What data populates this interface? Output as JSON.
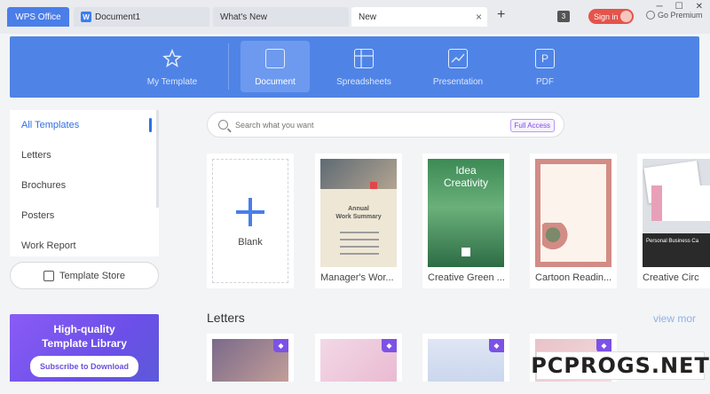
{
  "tabs": {
    "app": "WPS Office",
    "document": "Document1",
    "whats_new": "What's New",
    "new": "New",
    "add_icon": "+",
    "close_icon": "×"
  },
  "header": {
    "count_badge": "3",
    "sign_in": "Sign in",
    "premium": "Go Premium",
    "minimize": "─",
    "maximize": "☐",
    "close": "✕"
  },
  "categories": [
    {
      "label": "My Template",
      "icon": "star-icon"
    },
    {
      "label": "Document",
      "icon": "document-icon"
    },
    {
      "label": "Spreadsheets",
      "icon": "spreadsheet-icon"
    },
    {
      "label": "Presentation",
      "icon": "presentation-icon"
    },
    {
      "label": "PDF",
      "icon": "pdf-icon"
    }
  ],
  "sidebar": {
    "items": [
      "All Templates",
      "Letters",
      "Brochures",
      "Posters",
      "Work Report"
    ],
    "store_button": "Template Store",
    "promo_line1": "High-quality",
    "promo_line2": "Template Library",
    "promo_button": "Subscribe to Download"
  },
  "search": {
    "placeholder": "Search what you want",
    "full_access": "Full Access"
  },
  "templates": [
    {
      "label": "Blank"
    },
    {
      "label": "Manager's Wor..."
    },
    {
      "label": "Creative Green ..."
    },
    {
      "label": "Cartoon Readin..."
    },
    {
      "label": "Creative Circ"
    }
  ],
  "template_text": {
    "annual": "Annual",
    "work_summary": "Work Summary",
    "idea": "Idea",
    "creativity": "Creativity",
    "personal": "Personal Business Ca"
  },
  "letters": {
    "title": "Letters",
    "view_more": "view mor"
  },
  "watermark": "PCPROGS.NET",
  "colors": {
    "accent": "#4f84e6",
    "sign_in": "#e4544a",
    "vip": "#7c52e6"
  }
}
